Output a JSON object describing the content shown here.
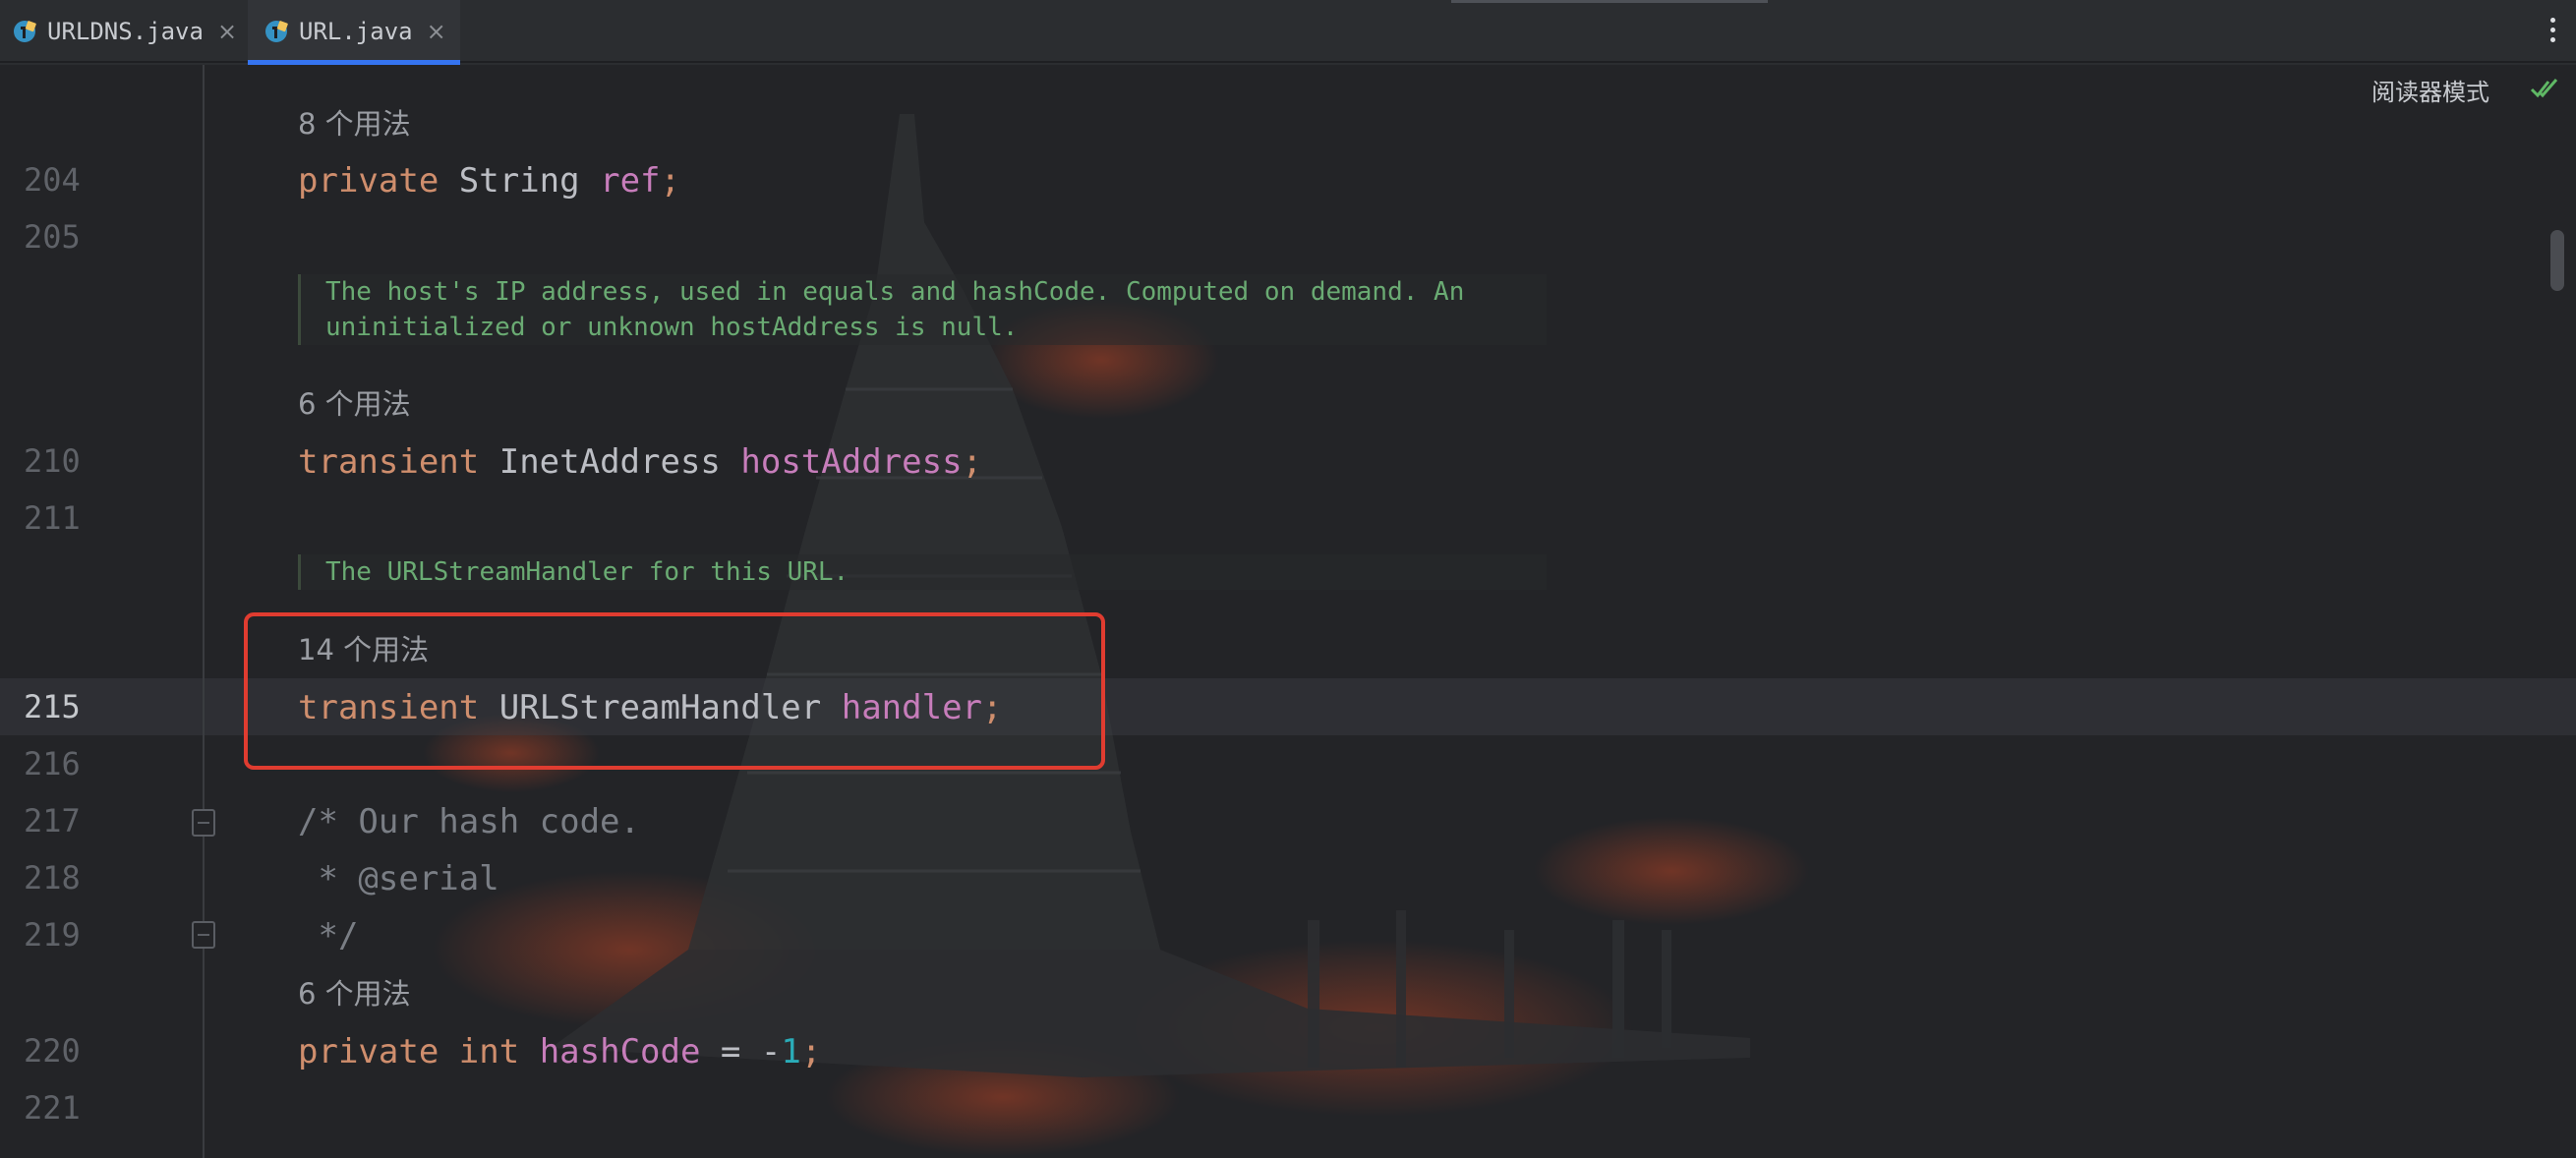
{
  "tabs": [
    {
      "label": "URLDNS.java",
      "close": "×",
      "icon": "java-class-icon",
      "active": false
    },
    {
      "label": "URL.java",
      "close": "×",
      "icon": "java-class-icon",
      "active": true
    }
  ],
  "toolbar": {
    "reader_mode": "阅读器模式",
    "inspection_icon": "double-check-icon"
  },
  "editor": {
    "usages": [
      {
        "text": "8 个用法"
      },
      {
        "text": "6 个用法"
      },
      {
        "text": "14 个用法"
      },
      {
        "text": "6 个用法"
      }
    ],
    "line_numbers": [
      "204",
      "205",
      "210",
      "211",
      "215",
      "216",
      "217",
      "218",
      "219",
      "220",
      "221"
    ],
    "current_line": "215",
    "docs": [
      {
        "line1": "The host's IP address, used in equals and hashCode. Computed on demand. An",
        "line2": "uninitialized or unknown hostAddress is null."
      },
      {
        "line1": "The URLStreamHandler for this URL."
      }
    ],
    "code": {
      "l204": {
        "kw": "private",
        "type": "String",
        "name": "ref",
        "end": ";"
      },
      "l210": {
        "kw": "transient",
        "type": "InetAddress",
        "name": "hostAddress",
        "end": ";"
      },
      "l215": {
        "kw": "transient",
        "type": "URLStreamHandler",
        "name": "handler",
        "end": ";"
      },
      "l217": "/* Our hash code.",
      "l218": " * @serial",
      "l219": " */",
      "l220": {
        "kw1": "private",
        "kw2": "int",
        "name": "hashCode",
        "op": " = -",
        "num": "1",
        "end": ";"
      }
    }
  },
  "colors": {
    "accent": "#3574f0",
    "highlight_box": "#e03c30",
    "keyword": "#cf8e6d",
    "field": "#c77dbb",
    "doc_comment": "#6aab73",
    "number": "#2aacb8"
  }
}
